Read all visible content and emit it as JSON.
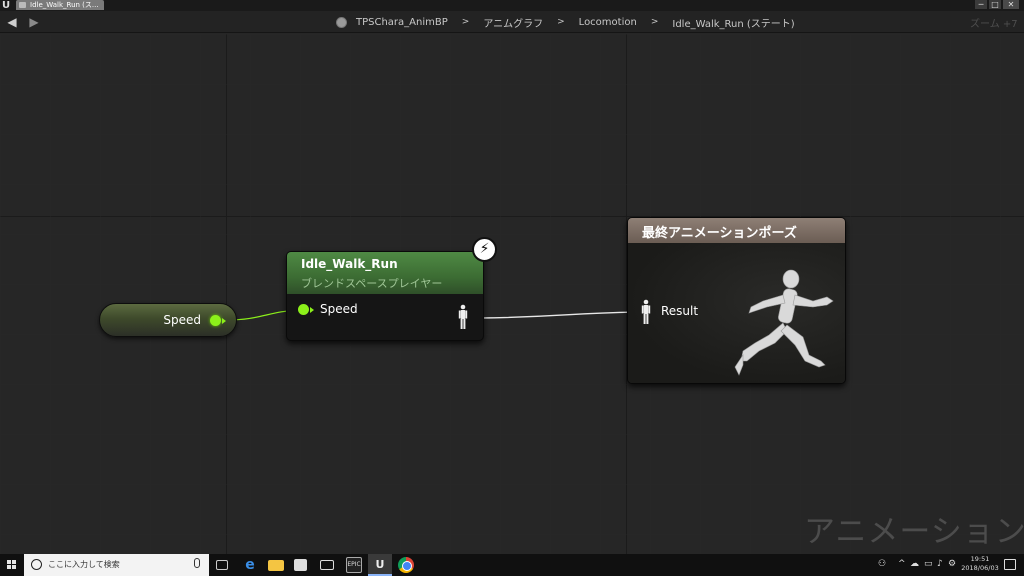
{
  "window": {
    "tab_label": "Idle_Walk_Run (ス...",
    "minimize_glyph": "─",
    "maximize_glyph": "□",
    "close_glyph": "✕"
  },
  "toolbar": {
    "back_icon": "arrow-left-icon",
    "forward_icon": "arrow-right-icon",
    "breadcrumb": [
      "TPSChara_AnimBP",
      "アニムグラフ",
      "Locomotion",
      "Idle_Walk_Run (ステート)"
    ],
    "separator": ">",
    "zoom_label": "ズーム +7"
  },
  "graph": {
    "variable_node": {
      "label": "Speed",
      "pin_color": "#8cf01a"
    },
    "blend_node": {
      "title": "Idle_Walk_Run",
      "subtitle": "ブレンドスペースプレイヤー",
      "input_label": "Speed",
      "header_color": "#4f8a44",
      "badge_icon": "lightning-icon",
      "badge_glyph": "⚡"
    },
    "output_node": {
      "title": "最終アニメーションポーズ",
      "input_label": "Result",
      "header_color": "#8e7f75"
    },
    "watermark": "アニメーション"
  },
  "taskbar": {
    "search_placeholder": "ここに入力して検索",
    "epic_label": "EPIC",
    "ue_label": "U",
    "clock_time": "19:51",
    "clock_date": "2018/06/03"
  }
}
